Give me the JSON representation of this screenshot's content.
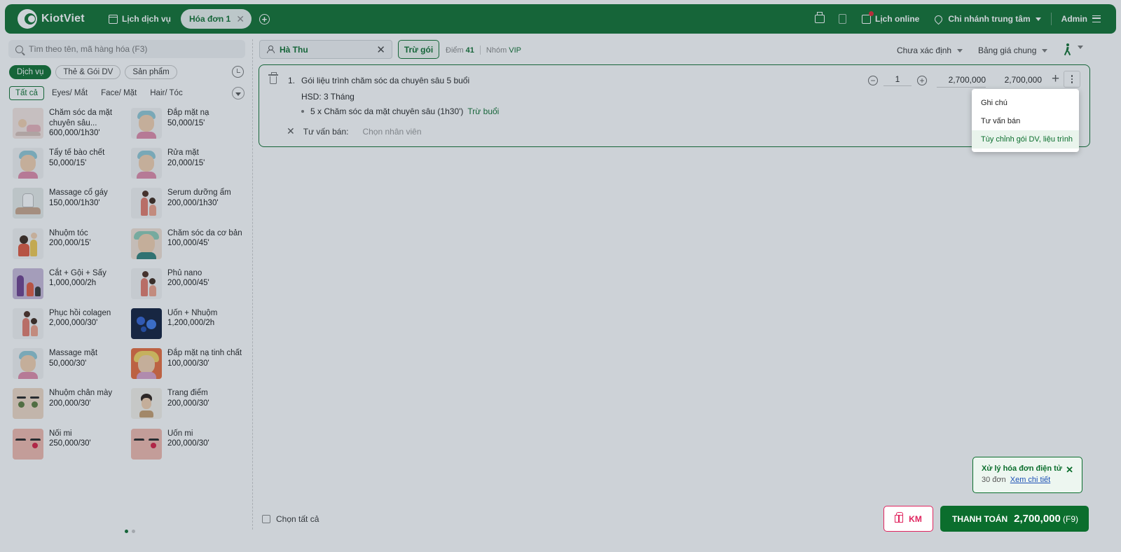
{
  "header": {
    "brand": "KiotViet",
    "nav_schedule": "Lịch dịch vụ",
    "active_tab": "Hóa đơn 1",
    "close_tab": "✕",
    "add_tab": "+",
    "online_schedule": "Lịch online",
    "branch": "Chi nhánh trung tâm",
    "user": "Admin"
  },
  "left": {
    "search_placeholder": "Tìm theo tên, mã hàng hóa (F3)",
    "categories": [
      "Dịch vụ",
      "Thẻ & Gói DV",
      "Sản phẩm"
    ],
    "subcategories": [
      "Tất cả",
      "Eyes/ Mắt",
      "Face/ Mặt",
      "Hair/ Tóc"
    ],
    "products": [
      {
        "name": "Chăm sóc da mặt chuyên sâu...",
        "price": "600,000/1h30'"
      },
      {
        "name": "Đắp mặt nạ",
        "price": "50,000/15'"
      },
      {
        "name": "Tẩy tế bào chết",
        "price": "50,000/15'"
      },
      {
        "name": "Rửa mặt",
        "price": "20,000/15'"
      },
      {
        "name": "Massage cổ gáy",
        "price": "150,000/1h30'"
      },
      {
        "name": "Serum dưỡng ẩm",
        "price": "200,000/1h30'"
      },
      {
        "name": "Nhuộm tóc",
        "price": "200,000/15'"
      },
      {
        "name": "Chăm sóc da cơ bản",
        "price": "100,000/45'"
      },
      {
        "name": "Cắt + Gội + Sấy",
        "price": "1,000,000/2h"
      },
      {
        "name": "Phủ nano",
        "price": "200,000/45'"
      },
      {
        "name": "Phục hồi colagen",
        "price": "2,000,000/30'"
      },
      {
        "name": "Uốn + Nhuộm",
        "price": "1,200,000/2h"
      },
      {
        "name": "Massage mặt",
        "price": "50,000/30'"
      },
      {
        "name": "Đắp mặt nạ tinh chất",
        "price": "100,000/30'"
      },
      {
        "name": "Nhuộm chân mày",
        "price": "200,000/30'"
      },
      {
        "name": "Trang điểm",
        "price": "200,000/30'"
      },
      {
        "name": "Nối mi",
        "price": "250,000/30'"
      },
      {
        "name": "Uốn mi",
        "price": "200,000/30'"
      }
    ]
  },
  "customer": {
    "name": "Hà Thu",
    "clear": "✕",
    "deduct_button": "Trừ gói",
    "points_label": "Điểm",
    "points": "41",
    "group_label": "Nhóm",
    "group": "VIP"
  },
  "filters": {
    "undetermined": "Chưa xác định",
    "price_list": "Bảng giá chung"
  },
  "line": {
    "index": "1.",
    "name": "Gói liệu trình chăm sóc da chuyên sâu 5 buổi",
    "expiry": "HSD: 3 Tháng",
    "session": "5 x Chăm sóc da mặt chuyên sâu (1h30')",
    "session_action": "Trừ buổi",
    "staff_clear": "✕",
    "staff_label": "Tư vấn bán:",
    "staff_placeholder": "Chọn nhân viên",
    "minus": "−",
    "quantity": "1",
    "plus": "+",
    "unit_price": "2,700,000",
    "total": "2,700,000",
    "add": "+"
  },
  "menu": {
    "items": [
      "Ghi chú",
      "Tư vấn bán",
      "Tùy chỉnh gói DV, liệu trình"
    ]
  },
  "einvoice": {
    "title": "Xử lý hóa đơn điện tử",
    "close": "✕",
    "count": "30 đơn",
    "link": "Xem chi tiết"
  },
  "footer": {
    "select_all": "Chọn tất cả",
    "promo": "KM",
    "pay_label": "THANH TOÁN",
    "pay_amount": "2,700,000",
    "pay_key": "(F9)"
  },
  "colors": {
    "brand": "#0b6e2d",
    "promo": "#e0245e",
    "notification": "#e0242f"
  }
}
